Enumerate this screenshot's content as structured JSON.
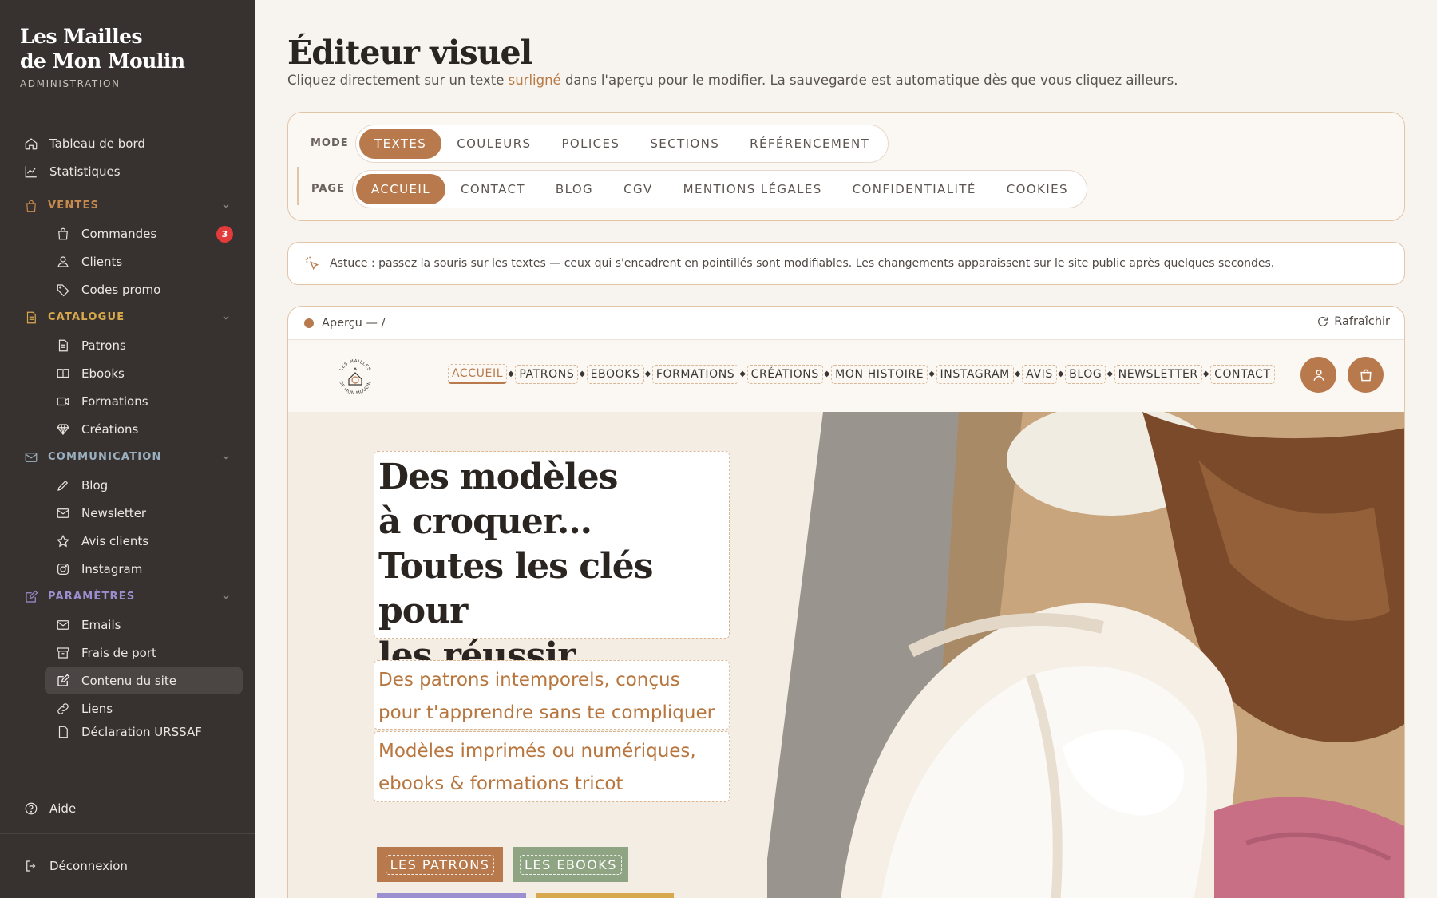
{
  "sidebar": {
    "brand_line1": "Les Mailles",
    "brand_line2": "de Mon Moulin",
    "brand_sub": "ADMINISTRATION",
    "top_items": [
      {
        "label": "Tableau de bord",
        "icon": "home-icon"
      },
      {
        "label": "Statistiques",
        "icon": "chart-line-icon"
      }
    ],
    "sections": {
      "ventes": {
        "label": "VENTES",
        "color": "#c68a4e",
        "items": [
          {
            "label": "Commandes",
            "icon": "bag-icon",
            "badge": "3"
          },
          {
            "label": "Clients",
            "icon": "users-icon"
          },
          {
            "label": "Codes promo",
            "icon": "tag-icon"
          }
        ]
      },
      "catalogue": {
        "label": "CATALOGUE",
        "color": "#d8a94c",
        "items": [
          {
            "label": "Patrons",
            "icon": "document-icon"
          },
          {
            "label": "Ebooks",
            "icon": "book-icon"
          },
          {
            "label": "Formations",
            "icon": "video-icon"
          },
          {
            "label": "Créations",
            "icon": "diamond-icon"
          }
        ]
      },
      "communication": {
        "label": "COMMUNICATION",
        "color": "#9ab0bf",
        "items": [
          {
            "label": "Blog",
            "icon": "pencil-icon"
          },
          {
            "label": "Newsletter",
            "icon": "mail-icon"
          },
          {
            "label": "Avis clients",
            "icon": "star-icon"
          },
          {
            "label": "Instagram",
            "icon": "instagram-icon"
          }
        ]
      },
      "parametres": {
        "label": "PARAMÈTRES",
        "color": "#9b8fd0",
        "items": [
          {
            "label": "Emails",
            "icon": "mail-icon"
          },
          {
            "label": "Frais de port",
            "icon": "box-icon"
          },
          {
            "label": "Contenu du site",
            "icon": "edit-icon",
            "active": true
          },
          {
            "label": "Liens",
            "icon": "link-icon"
          },
          {
            "label": "Déclaration URSSAF",
            "icon": "file-icon"
          }
        ]
      }
    },
    "help_label": "Aide",
    "logout_label": "Déconnexion"
  },
  "main": {
    "title": "Éditeur visuel",
    "desc_before": "Cliquez directement sur un texte ",
    "desc_highlight": "surligné",
    "desc_after": " dans l'aperçu pour le modifier. La sauvegarde est automatique dès que vous cliquez ailleurs.",
    "mode_label": "MODE",
    "modes": [
      "TEXTES",
      "COULEURS",
      "POLICES",
      "SECTIONS",
      "RÉFÉRENCEMENT"
    ],
    "active_mode": "TEXTES",
    "page_label": "PAGE",
    "pages": [
      "ACCUEIL",
      "CONTACT",
      "BLOG",
      "CGV",
      "MENTIONS LÉGALES",
      "CONFIDENTIALITÉ",
      "COOKIES"
    ],
    "active_page": "ACCUEIL",
    "tip": "Astuce : passez la souris sur les textes — ceux qui s'encadrent en pointillés sont modifiables. Les changements apparaissent sur le site public après quelques secondes."
  },
  "preview": {
    "label": "Aperçu — /",
    "refresh_label": "Rafraîchir",
    "logo_text_top": "LES MAILLES",
    "logo_text_bottom": "DE MON MOULIN",
    "nav": [
      "ACCUEIL",
      "PATRONS",
      "EBOOKS",
      "FORMATIONS",
      "CRÉATIONS",
      "MON HISTOIRE",
      "INSTAGRAM",
      "AVIS",
      "BLOG",
      "NEWSLETTER",
      "CONTACT"
    ],
    "hero_title_lines": [
      "Des modèles",
      "à croquer...",
      "Toutes les clés pour",
      "les réussir."
    ],
    "hero_sub1": "Des patrons intemporels, conçus pour t'apprendre sans te compliquer la vie",
    "hero_sub2": "Modèles imprimés ou numériques, ebooks & formations tricot",
    "cta_patrons": "LES PATRONS",
    "cta_ebooks": "LES EBOOKS"
  },
  "colors": {
    "accent": "#b87a4d",
    "sidebar_bg": "#373230",
    "badge": "#e23b3b",
    "sage": "#8fa482",
    "lavender": "#9b8fd0",
    "mustard": "#d8a94c"
  }
}
